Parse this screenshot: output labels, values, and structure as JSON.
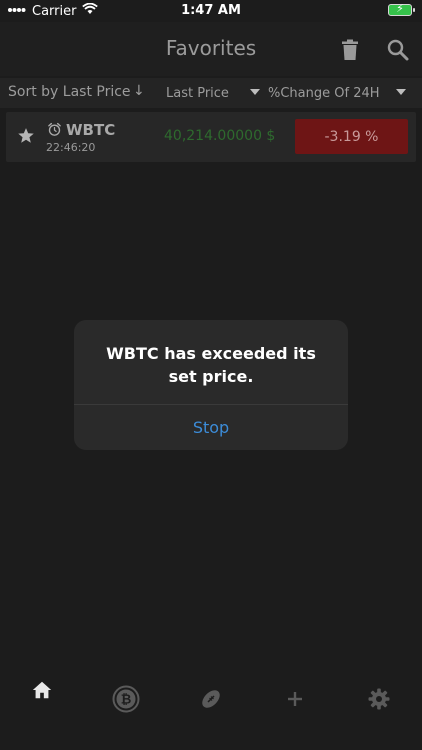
{
  "status_bar": {
    "carrier": "Carrier",
    "time": "1:47 AM"
  },
  "navbar": {
    "title": "Favorites"
  },
  "sortbar": {
    "sort_label": "Sort by Last Price",
    "sort_arrow": "↓",
    "col_last_price": "Last Price",
    "col_change": "%Change Of 24H"
  },
  "favorites": [
    {
      "symbol": "WBTC",
      "time": "22:46:20",
      "price": "40,214.00000 $",
      "change": "-3.19 %"
    }
  ],
  "alert": {
    "message": "WBTC  has exceeded its set price.",
    "button": "Stop"
  },
  "colors": {
    "background": "#1c1c1c",
    "price_up": "#2e6a2e",
    "change_negative_bg": "#6e1515",
    "alert_link": "#3c8cd8"
  },
  "icons": {
    "nav": [
      "trash-icon",
      "search-icon"
    ],
    "row": [
      "star-icon",
      "alarm-icon"
    ],
    "tabs": [
      "home-icon",
      "bitcoin-icon",
      "football-icon",
      "add-icon",
      "gear-icon"
    ]
  }
}
